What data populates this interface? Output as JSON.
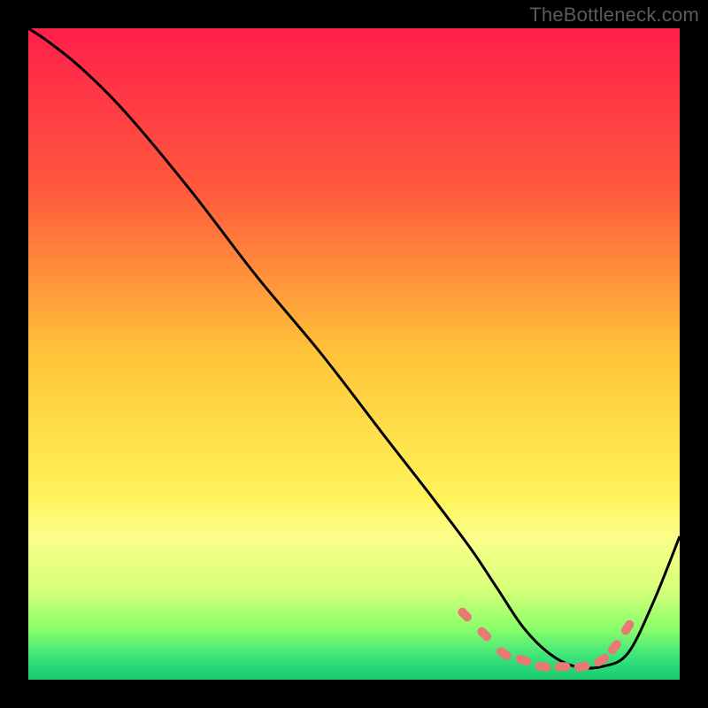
{
  "watermark": "TheBottleneck.com",
  "chart_data": {
    "type": "line",
    "title": "",
    "xlabel": "",
    "ylabel": "",
    "xlim": [
      0,
      100
    ],
    "ylim": [
      0,
      100
    ],
    "series": [
      {
        "name": "curve",
        "x": [
          0,
          3,
          8,
          15,
          25,
          35,
          45,
          55,
          62,
          68,
          72,
          76,
          80,
          84,
          88,
          92,
          96,
          100
        ],
        "y": [
          100,
          98,
          94,
          87,
          75,
          62,
          50,
          37,
          28,
          20,
          14,
          8,
          4,
          2,
          2,
          4,
          12,
          22
        ]
      }
    ],
    "markers": {
      "name": "bottom-markers",
      "x": [
        67,
        70,
        73,
        76,
        79,
        82,
        85,
        88,
        90,
        92
      ],
      "y": [
        10,
        7,
        4,
        3,
        2,
        2,
        2,
        3,
        5,
        8
      ]
    },
    "gradient_stops": [
      {
        "offset": 0,
        "color": "#ff1f4b"
      },
      {
        "offset": 25,
        "color": "#ff5a3c"
      },
      {
        "offset": 50,
        "color": "#ffc43a"
      },
      {
        "offset": 72,
        "color": "#fff35a"
      },
      {
        "offset": 78,
        "color": "#fbff8a"
      },
      {
        "offset": 86,
        "color": "#d8ff7a"
      },
      {
        "offset": 92,
        "color": "#8cff6a"
      },
      {
        "offset": 97,
        "color": "#33e07a"
      },
      {
        "offset": 100,
        "color": "#19c96c"
      }
    ],
    "curve_color": "#000000",
    "marker_color": "#e77a74"
  }
}
